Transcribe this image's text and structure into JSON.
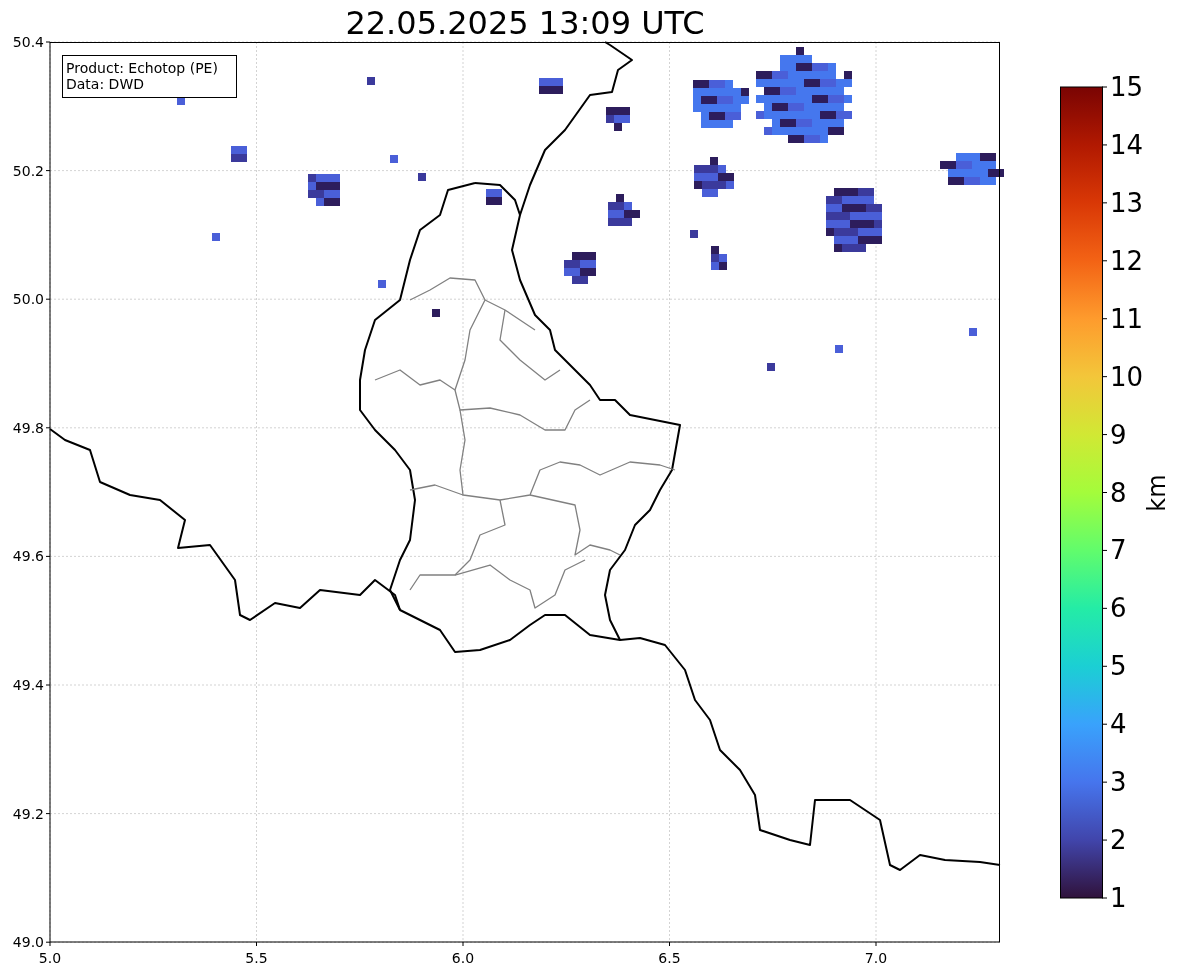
{
  "title": "22.05.2025 13:09 UTC",
  "info_box": [
    "Product: Echotop (PE)",
    "Data: DWD"
  ],
  "x_ticks": [
    "5.0",
    "5.5",
    "6.0",
    "6.5",
    "7.0"
  ],
  "y_ticks": [
    "50.4",
    "50.2",
    "50.0",
    "49.8",
    "49.6",
    "49.4",
    "49.2",
    "49.0"
  ],
  "colorbar": {
    "label": "km",
    "ticks": [
      "15",
      "14",
      "13",
      "12",
      "11",
      "10",
      "9",
      "8",
      "7",
      "6",
      "5",
      "4",
      "3",
      "2",
      "1"
    ]
  }
}
